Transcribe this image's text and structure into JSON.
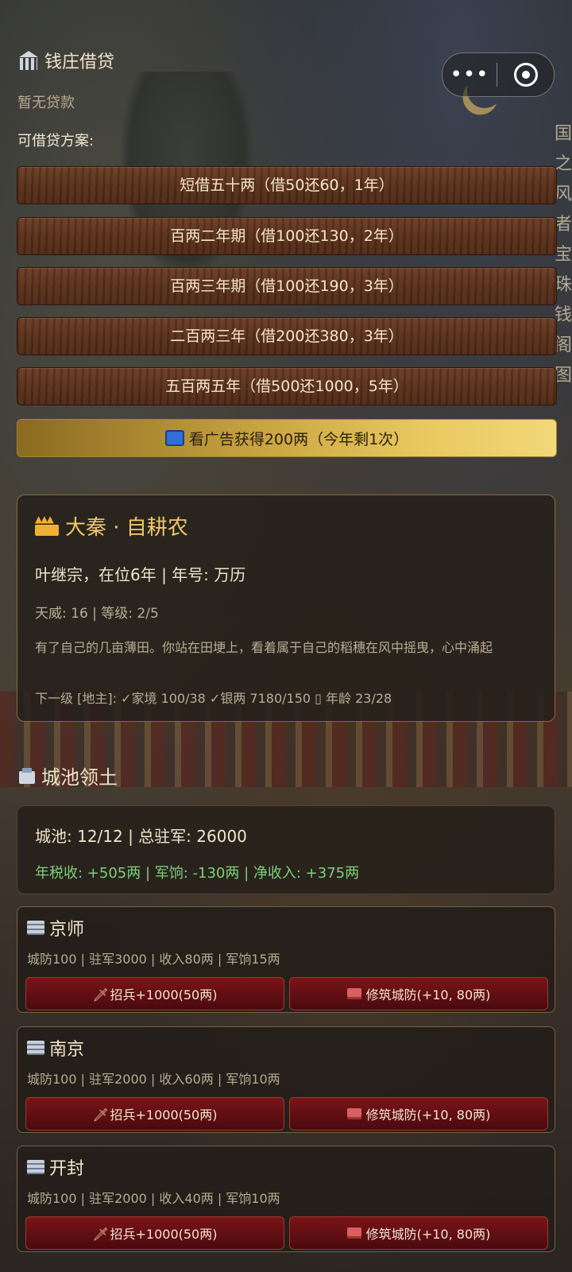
{
  "top_capsule": {
    "more_icon": "more-icon",
    "close_icon": "target-icon"
  },
  "bank": {
    "title": "钱庄借贷",
    "status": "暂无贷款",
    "plans_label": "可借贷方案:",
    "plans": [
      "短借五十两（借50还60，1年）",
      "百两二年期（借100还130，2年）",
      "百两三年期（借100还190，3年）",
      "二百两三年（借200还380，3年）",
      "五百两五年（借500还1000，5年）"
    ],
    "ad_button": "看广告获得200两（今年剩1次）"
  },
  "dynasty": {
    "title": "大秦 · 自耕农",
    "ruler_line": "叶继宗，在位6年 | 年号: 万历",
    "stats_line": "天威: 16 | 等级: 2/5",
    "description": "有了自己的几亩薄田。你站在田埂上，看着属于自己的稻穗在风中摇曳，心中涌起",
    "next_level": "下一级 [地主]: ✓家境 100/38 ✓银两 7180/150 ▯ 年龄 23/28"
  },
  "territory": {
    "title": "城池领土",
    "summary_line": "城池: 12/12 | 总驻军: 26000",
    "income_line": "年税收: +505两 | 军饷: -130两 | 净收入: +375两"
  },
  "cities": [
    {
      "name": "京师",
      "info": "城防100 | 驻军3000 | 收入80两 | 军饷15两",
      "recruit": "招兵+1000(50两)",
      "fortify": "修筑城防(+10, 80两)"
    },
    {
      "name": "南京",
      "info": "城防100 | 驻军2000 | 收入60两 | 军饷10两",
      "recruit": "招兵+1000(50两)",
      "fortify": "修筑城防(+10, 80两)"
    },
    {
      "name": "开封",
      "info": "城防100 | 驻军2000 | 收入40两 | 军饷10两",
      "recruit": "招兵+1000(50两)",
      "fortify": "修筑城防(+10, 80两)"
    }
  ],
  "side_text": "国之风者宝珠钱阁图"
}
